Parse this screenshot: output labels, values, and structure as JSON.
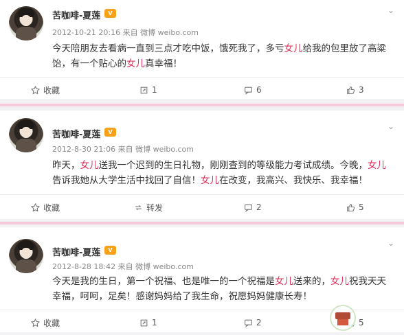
{
  "posts": [
    {
      "name": "苦咖啡-夏莲",
      "meta": "2012-10-21 20:16 来自 微博 weibo.com",
      "text": "今天陪朋友去看病一直到三点才吃中饭，饿死我了，多亏女儿给我的包里放了高粱饴，有一个贴心的女儿真幸福！",
      "actions": {
        "collect": "收藏",
        "repost": "1",
        "comment": "6",
        "like": "3"
      }
    },
    {
      "name": "苦咖啡-夏莲",
      "meta": "2012-8-30 21:06 来自 微博 weibo.com",
      "text": "昨天，女儿送我一个迟到的生日礼物，刚刚查到的等级能力考试成绩。今晚，女儿告诉我她从大学生活中找回了自信！女儿在改变，我高兴、我快乐、我幸福！",
      "actions": {
        "collect": "收藏",
        "repost": "转发",
        "comment": "2",
        "like": "5"
      }
    },
    {
      "name": "苦咖啡-夏莲",
      "meta": "2012-8-28 18:42 来自 微博 weibo.com",
      "text": "今天是我的生日，第一个祝福、也是唯一的一个祝福是女儿送来的，女儿祝我天天幸福，呵呵，足矣！感谢妈妈给了我生命，祝愿妈妈健康长寿！",
      "actions": {
        "collect": "收藏",
        "repost": "1",
        "comment": "2",
        "like": "5"
      }
    }
  ],
  "icons": {
    "star": "star-icon",
    "repost": "repost-icon",
    "comment": "comment-icon",
    "like": "thumbs-up-icon",
    "vip": "vip-badge-icon",
    "caret": "chevron-down-icon"
  },
  "colors": {
    "highlight": "#e0315a",
    "background": "#f2f2f5",
    "separator": "#f6c9d9",
    "vip": "#f7a11a"
  }
}
